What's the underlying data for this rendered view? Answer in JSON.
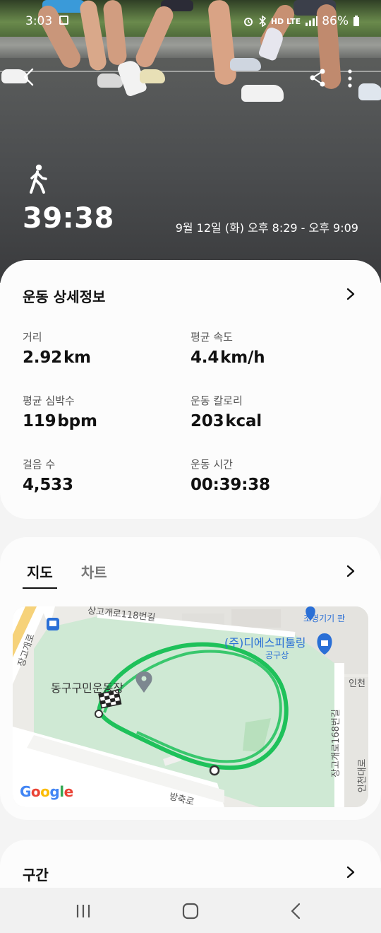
{
  "status_bar": {
    "time": "3:03",
    "network": "HD LTE",
    "battery": "86%"
  },
  "hero": {
    "duration": "39:38",
    "datetime": "9월 12일 (화) 오후 8:29 - 오후 9:09"
  },
  "details": {
    "title": "운동 상세정보",
    "stats": [
      {
        "label": "거리",
        "value": "2.92",
        "unit": "km"
      },
      {
        "label": "평균 속도",
        "value": "4.4",
        "unit": "km/h"
      },
      {
        "label": "평균 심박수",
        "value": "119",
        "unit": "bpm"
      },
      {
        "label": "운동 칼로리",
        "value": "203",
        "unit": "kcal"
      },
      {
        "label": "걸음 수",
        "value": "4,533",
        "unit": ""
      },
      {
        "label": "운동 시간",
        "value": "00:39:38",
        "unit": ""
      }
    ]
  },
  "map_section": {
    "tabs": [
      "지도",
      "차트"
    ],
    "active_tab": "지도",
    "labels": {
      "road_top": "상고개로118번길",
      "road_left": "장고개로",
      "stadium": "동구구민운동장",
      "company": "(주)디에스피툴링",
      "company_sub": "공구상",
      "lighting": "조명기기 판",
      "right_road": "인천",
      "vertical_road": "장고개로168번길",
      "right_vertical": "인천대로",
      "bottom_road": "방축로"
    },
    "attribution": "Google",
    "colors": {
      "route": "#1ec15a",
      "park": "#cfe9d4",
      "poi_blue": "#2a6fd6"
    }
  },
  "segment": {
    "title": "구간"
  },
  "icons": {
    "activity": "walking-icon",
    "back": "back-arrow-icon",
    "share": "share-icon",
    "more": "more-vert-icon",
    "chevron": "chevron-right-icon"
  }
}
